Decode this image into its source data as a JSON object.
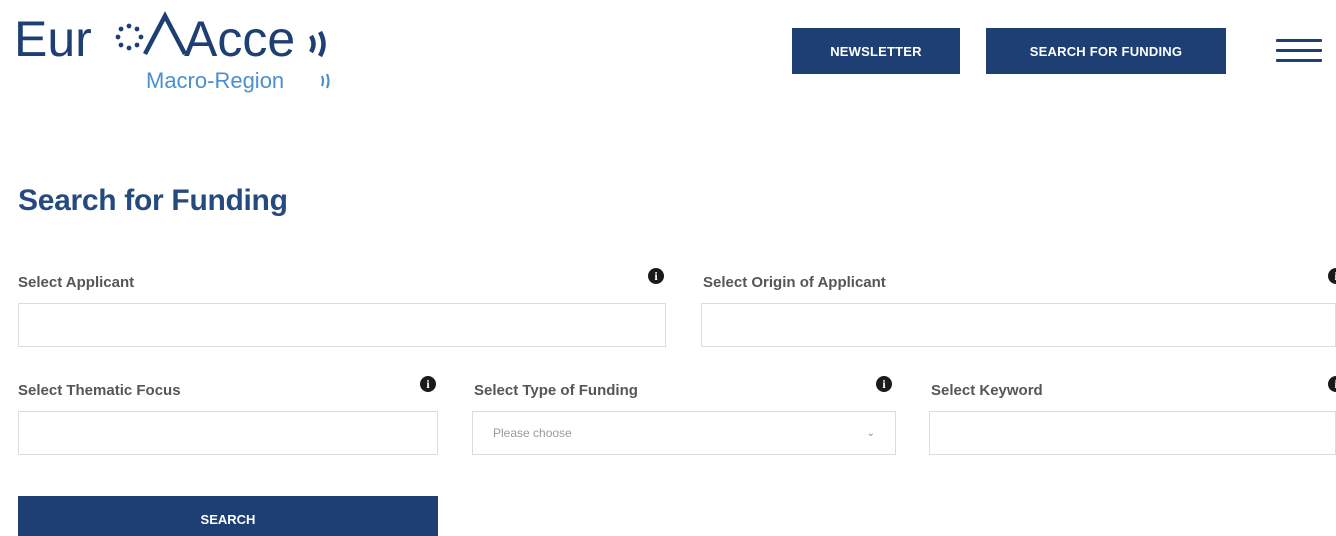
{
  "brand": {
    "name_part1": "Eur",
    "name_part2": "Acce",
    "sub": "Macro-Region",
    "colors": {
      "primary": "#1d3f74",
      "secondary": "#4a90cf"
    }
  },
  "header": {
    "newsletter_label": "NEWSLETTER",
    "search_funding_label": "SEARCH FOR FUNDING",
    "menu_icon": "hamburger-menu-icon"
  },
  "main": {
    "title": "Search for Funding",
    "fields": {
      "applicant": {
        "label": "Select Applicant",
        "value": ""
      },
      "origin": {
        "label": "Select Origin of Applicant",
        "value": ""
      },
      "thematic": {
        "label": "Select Thematic Focus",
        "value": ""
      },
      "funding_type": {
        "label": "Select Type of Funding",
        "selected": "Please choose"
      },
      "keyword": {
        "label": "Select Keyword",
        "value": ""
      }
    },
    "info_glyph": "i",
    "search_label": "SEARCH"
  }
}
